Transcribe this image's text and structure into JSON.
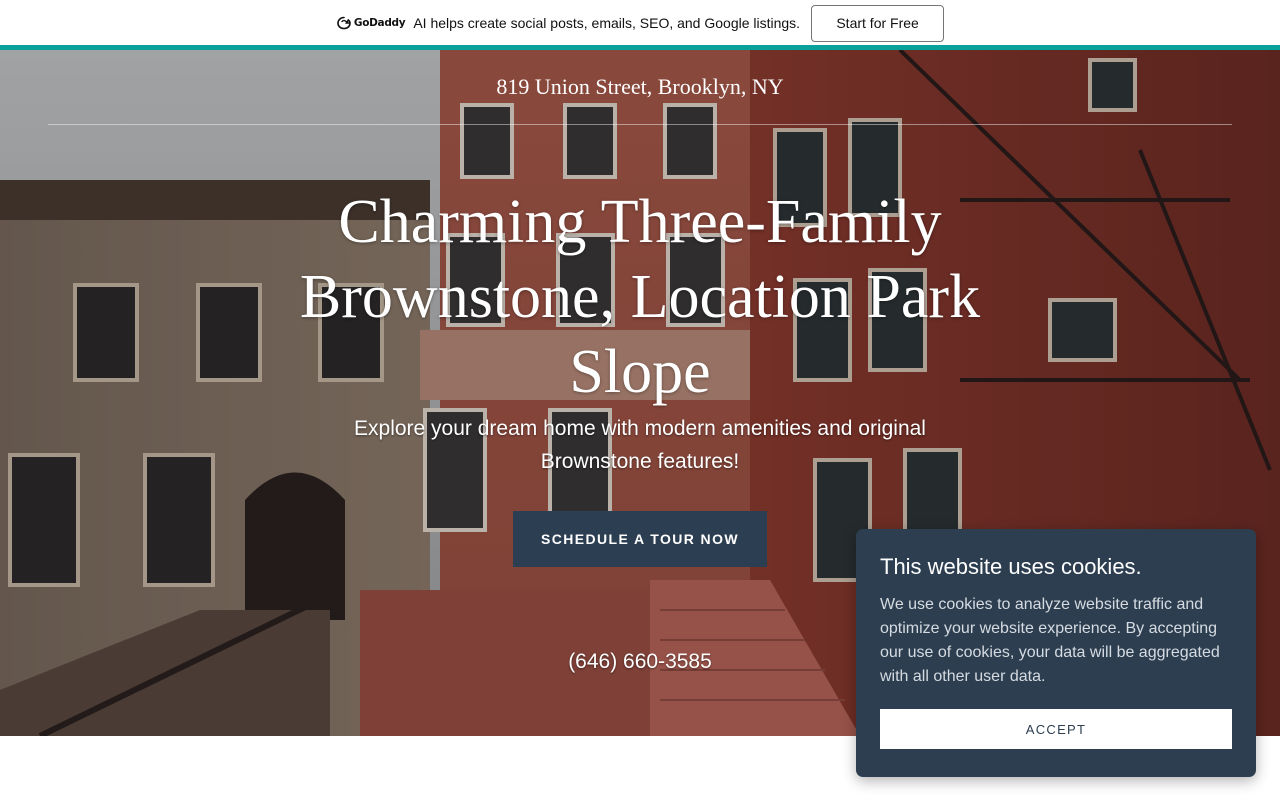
{
  "promo": {
    "brand_name": "GoDaddy",
    "brand_icon": "godaddy-logo-icon",
    "text": "AI helps create social posts, emails, SEO, and Google listings.",
    "cta_label": "Start for Free"
  },
  "colors": {
    "teal_strip": "#09a29a",
    "button_navy": "#2c3e52",
    "cookie_bg": "#2c3e50"
  },
  "header": {
    "site_title": "819 Union Street, Brooklyn, NY"
  },
  "hero": {
    "title": "Charming Three-Family Brownstone, Location Park Slope",
    "subtitle": "Explore your dream home with modern amenities and original Brownstone features!",
    "cta_label": "SCHEDULE A TOUR NOW",
    "phone": "(646) 660-3585"
  },
  "cookie": {
    "title": "This website uses cookies.",
    "body": "We use cookies to analyze website traffic and optimize your website experience. By accepting our use of cookies, your data will be aggregated with all other user data.",
    "accept_label": "ACCEPT"
  }
}
